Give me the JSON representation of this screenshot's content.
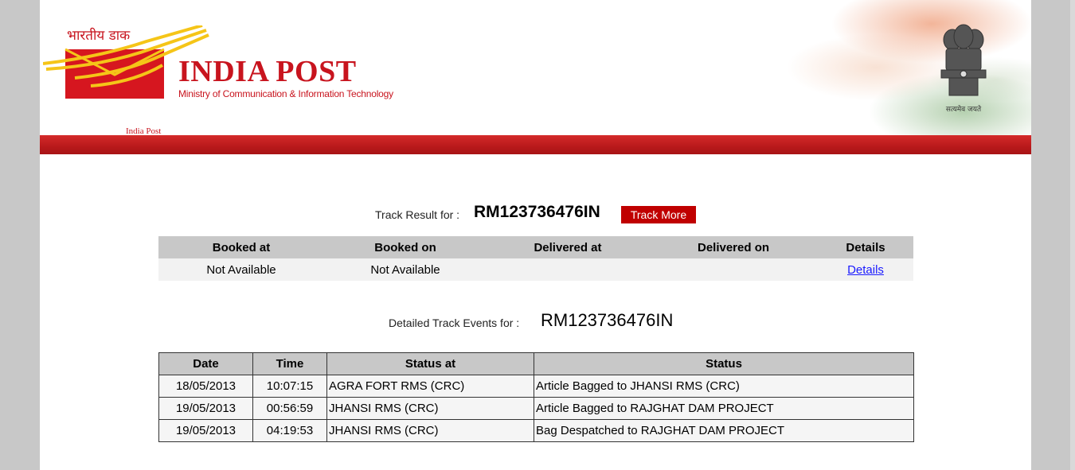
{
  "header": {
    "hindi_brand": "भारतीय डाक",
    "brand_name": "INDIA POST",
    "ministry": "Ministry of Communication & Information Technology",
    "logo_caption": "India Post",
    "emblem_caption": "सत्यमेव जयते",
    "brand_color": "#c8141e",
    "logo_yellow": "#f5c518"
  },
  "track_result": {
    "label": "Track Result for :",
    "tracking_number": "RM123736476IN",
    "track_more_label": "Track More"
  },
  "summary": {
    "headers": [
      "Booked at",
      "Booked on",
      "Delivered at",
      "Delivered on",
      "Details"
    ],
    "row": {
      "booked_at": "Not Available",
      "booked_on": "Not Available",
      "delivered_at": "",
      "delivered_on": "",
      "details_link": "Details"
    }
  },
  "events": {
    "label": "Detailed Track Events for :",
    "tracking_number": "RM123736476IN",
    "headers": [
      "Date",
      "Time",
      "Status at",
      "Status"
    ],
    "rows": [
      {
        "date": "18/05/2013",
        "time": "10:07:15",
        "status_at": "AGRA FORT RMS (CRC)",
        "status": "Article Bagged to JHANSI RMS (CRC)"
      },
      {
        "date": "19/05/2013",
        "time": "00:56:59",
        "status_at": "JHANSI RMS (CRC)",
        "status": "Article Bagged to RAJGHAT DAM PROJECT"
      },
      {
        "date": "19/05/2013",
        "time": "04:19:53",
        "status_at": "JHANSI RMS (CRC)",
        "status": "Bag Despatched to RAJGHAT DAM PROJECT"
      }
    ]
  },
  "colors": {
    "accent_red": "#c00000",
    "header_bar": "#b8191b",
    "table_header_bg": "#c8c8c8",
    "link": "#1a1aff"
  }
}
